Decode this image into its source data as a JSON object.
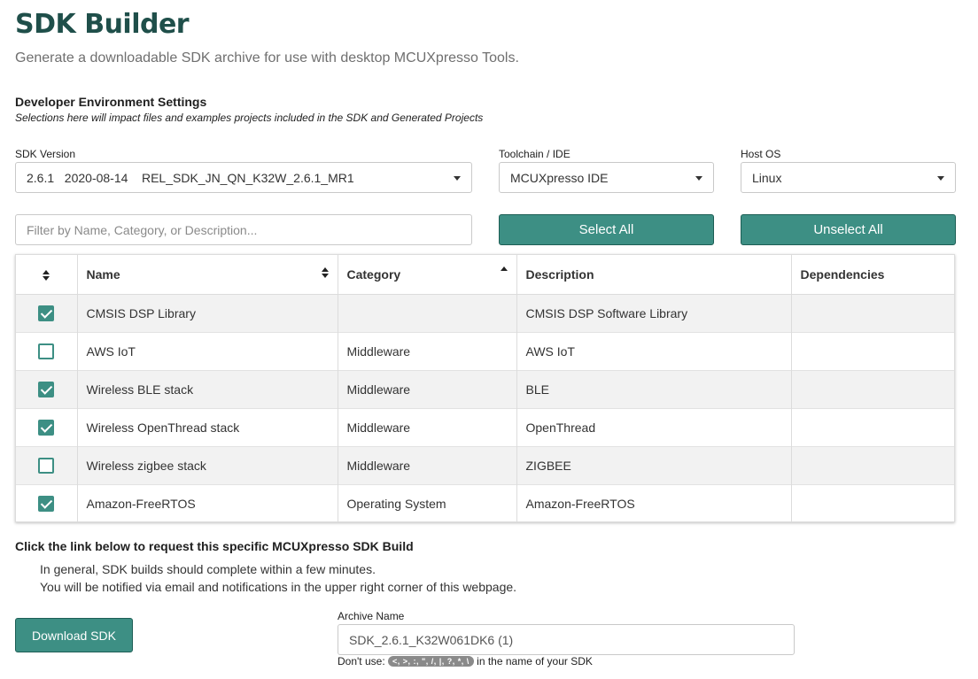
{
  "header": {
    "title": "SDK Builder",
    "subtitle": "Generate a downloadable SDK archive for use with desktop MCUXpresso Tools."
  },
  "dev_env": {
    "title": "Developer Environment Settings",
    "note": "Selections here will impact files and examples projects included in the SDK and Generated Projects"
  },
  "sdk_version": {
    "label": "SDK Version",
    "value": "2.6.1   2020-08-14    REL_SDK_JN_QN_K32W_2.6.1_MR1"
  },
  "toolchain": {
    "label": "Toolchain / IDE",
    "value": "MCUXpresso IDE"
  },
  "host_os": {
    "label": "Host OS",
    "value": "Linux"
  },
  "filter": {
    "placeholder": "Filter by Name, Category, or Description..."
  },
  "buttons": {
    "select_all": "Select All",
    "unselect_all": "Unselect All",
    "download": "Download SDK"
  },
  "table": {
    "columns": {
      "name": "Name",
      "category": "Category",
      "description": "Description",
      "dependencies": "Dependencies"
    },
    "rows": [
      {
        "checked": true,
        "name": "CMSIS DSP Library",
        "category": "",
        "description": "CMSIS DSP Software Library",
        "dependencies": ""
      },
      {
        "checked": false,
        "name": "AWS IoT",
        "category": "Middleware",
        "description": "AWS IoT",
        "dependencies": ""
      },
      {
        "checked": true,
        "name": "Wireless BLE stack",
        "category": "Middleware",
        "description": "BLE",
        "dependencies": ""
      },
      {
        "checked": true,
        "name": "Wireless OpenThread stack",
        "category": "Middleware",
        "description": "OpenThread",
        "dependencies": ""
      },
      {
        "checked": false,
        "name": "Wireless zigbee stack",
        "category": "Middleware",
        "description": "ZIGBEE",
        "dependencies": ""
      },
      {
        "checked": true,
        "name": "Amazon-FreeRTOS",
        "category": "Operating System",
        "description": "Amazon-FreeRTOS",
        "dependencies": ""
      }
    ]
  },
  "request": {
    "title": "Click the link below to request this specific MCUXpresso SDK Build",
    "line1": "In general, SDK builds should complete within a few minutes.",
    "line2": "You will be notified via email and notifications in the upper right corner of this webpage."
  },
  "archive": {
    "label": "Archive Name",
    "value": "SDK_2.6.1_K32W061DK6 (1)",
    "hint_prefix": "Don't use:",
    "forbidden_chars": "<, >, :, \", /, |, ?, *, \\",
    "hint_suffix": "in the name of your SDK"
  },
  "colors": {
    "accent": "#3d8f84",
    "title": "#1f4f4a"
  }
}
